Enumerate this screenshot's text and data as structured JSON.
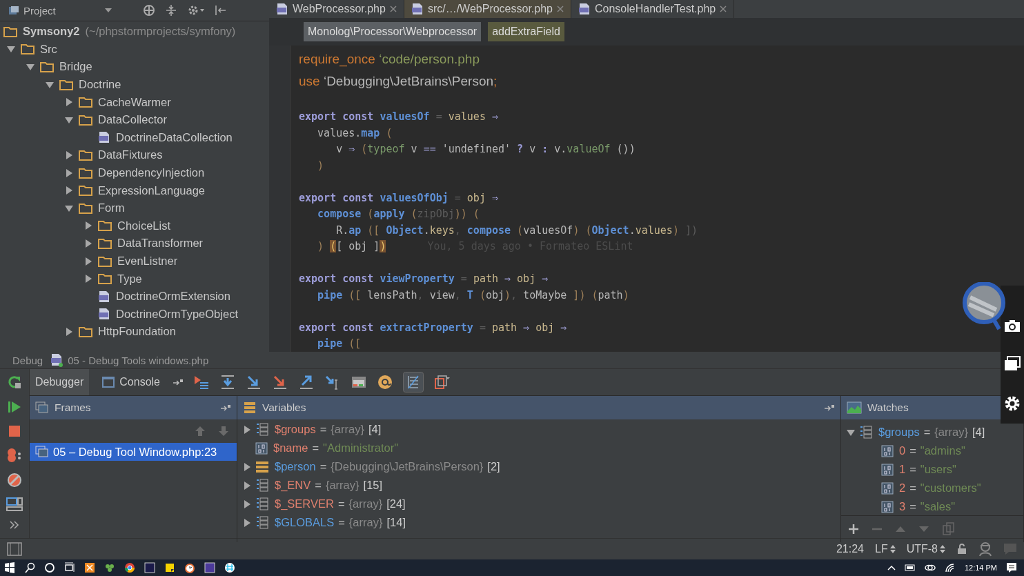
{
  "project_panel": {
    "title": "Project"
  },
  "editor_tabs": [
    {
      "label": "WebProcessor.php",
      "selected": false
    },
    {
      "label": "src/…/WebProcessor.php",
      "selected": true
    },
    {
      "label": "ConsoleHandlerTest.php",
      "selected": false
    }
  ],
  "breadcrumbs": [
    {
      "label": "Monolog\\Processor\\Webprocessor",
      "kind": "class"
    },
    {
      "label": "addExtraField",
      "kind": "method"
    }
  ],
  "tree": [
    {
      "label": "Symsony2",
      "path": "(~/phpstormprojects/symfony)",
      "kind": "project",
      "children": [
        {
          "label": "Src",
          "kind": "folder",
          "expanded": true,
          "children": [
            {
              "label": "Bridge",
              "kind": "folder",
              "expanded": true,
              "children": [
                {
                  "label": "Doctrine",
                  "kind": "folder",
                  "expanded": true,
                  "children": [
                    {
                      "label": "CacheWarmer",
                      "kind": "folder",
                      "expanded": false
                    },
                    {
                      "label": "DataCollector",
                      "kind": "folder",
                      "expanded": true,
                      "children": [
                        {
                          "label": "DoctrineDataCollection",
                          "kind": "file"
                        }
                      ]
                    },
                    {
                      "label": "DataFixtures",
                      "kind": "folder",
                      "expanded": false
                    },
                    {
                      "label": "DependencyInjection",
                      "kind": "folder",
                      "expanded": false
                    },
                    {
                      "label": "ExpressionLanguage",
                      "kind": "folder",
                      "expanded": false
                    },
                    {
                      "label": "Form",
                      "kind": "folder",
                      "expanded": true,
                      "children": [
                        {
                          "label": "ChoiceList",
                          "kind": "folder",
                          "expanded": false
                        },
                        {
                          "label": "DataTransformer",
                          "kind": "folder",
                          "expanded": false
                        },
                        {
                          "label": "EvenListner",
                          "kind": "folder",
                          "expanded": false
                        },
                        {
                          "label": "Type",
                          "kind": "folder",
                          "expanded": false
                        },
                        {
                          "label": "DoctrineOrmExtension",
                          "kind": "file"
                        },
                        {
                          "label": "DoctrineOrmTypeObject",
                          "kind": "file"
                        }
                      ]
                    },
                    {
                      "label": "HttpFoundation",
                      "kind": "folder",
                      "expanded": false
                    }
                  ]
                }
              ]
            }
          ]
        }
      ]
    }
  ],
  "code": [
    {
      "kind": "php",
      "tokens": [
        {
          "text": "require_once",
          "kind": "kw"
        },
        {
          "text": " ‘code/person.php",
          "kind": "str"
        }
      ]
    },
    {
      "kind": "php",
      "tokens": [
        {
          "text": "use",
          "kind": "kw"
        },
        {
          "text": " ‘Debugging\\JetBrains\\Person",
          "kind": "plain"
        },
        {
          "text": ";",
          "kind": "kw"
        }
      ]
    },
    {
      "kind": "blank"
    },
    {
      "kind": "code",
      "tokens": [
        {
          "text": "export const ",
          "kind": "decl"
        },
        {
          "text": "valuesOf",
          "kind": "fn"
        },
        {
          "text": " = ",
          "kind": "dim"
        },
        {
          "text": "values",
          "kind": "param"
        },
        {
          "text": " ⇒",
          "kind": "arrow"
        }
      ]
    },
    {
      "kind": "code",
      "tokens": [
        {
          "text": "   values.",
          "kind": "plain"
        },
        {
          "text": "map",
          "kind": "fn"
        },
        {
          "text": " (",
          "kind": "paren"
        }
      ]
    },
    {
      "kind": "code",
      "tokens": [
        {
          "text": "      v ",
          "kind": "plain"
        },
        {
          "text": "⇒ ",
          "kind": "arrow"
        },
        {
          "text": "(",
          "kind": "paren"
        },
        {
          "text": "typeof",
          "kind": "special"
        },
        {
          "text": " v ",
          "kind": "plain"
        },
        {
          "text": "== ",
          "kind": "arrow"
        },
        {
          "text": "'undefined' ",
          "kind": "plain"
        },
        {
          "text": "? ",
          "kind": "decl"
        },
        {
          "text": "v ",
          "kind": "plain"
        },
        {
          "text": ": ",
          "kind": "decl"
        },
        {
          "text": "v.",
          "kind": "plain"
        },
        {
          "text": "valueOf",
          "kind": "special"
        },
        {
          "text": " ())",
          "kind": "plain"
        }
      ]
    },
    {
      "kind": "code",
      "tokens": [
        {
          "text": "   )",
          "kind": "paren"
        }
      ]
    },
    {
      "kind": "blank"
    },
    {
      "kind": "code",
      "tokens": [
        {
          "text": "export const ",
          "kind": "decl"
        },
        {
          "text": "valuesOfObj",
          "kind": "fn"
        },
        {
          "text": " = ",
          "kind": "dim"
        },
        {
          "text": "obj",
          "kind": "param"
        },
        {
          "text": " ⇒",
          "kind": "arrow"
        }
      ]
    },
    {
      "kind": "code",
      "tokens": [
        {
          "text": "   compose",
          "kind": "fn"
        },
        {
          "text": " (",
          "kind": "paren"
        },
        {
          "text": "apply",
          "kind": "fn"
        },
        {
          "text": " (",
          "kind": "paren"
        },
        {
          "text": "zipObj",
          "kind": "dim"
        },
        {
          "text": "))",
          "kind": "paren"
        },
        {
          "text": " (",
          "kind": "paren"
        }
      ]
    },
    {
      "kind": "code",
      "tokens": [
        {
          "text": "      R.",
          "kind": "plain"
        },
        {
          "text": "ap",
          "kind": "fn"
        },
        {
          "text": " ([ ",
          "kind": "paren"
        },
        {
          "text": "Object",
          "kind": "fn"
        },
        {
          "text": ".",
          "kind": "plain"
        },
        {
          "text": "keys",
          "kind": "param"
        },
        {
          "text": ", ",
          "kind": "dim"
        },
        {
          "text": "compose",
          "kind": "fn"
        },
        {
          "text": " (",
          "kind": "paren"
        },
        {
          "text": "valuesOf",
          "kind": "plain"
        },
        {
          "text": ")",
          "kind": "paren"
        },
        {
          "text": " (",
          "kind": "paren"
        },
        {
          "text": "Object",
          "kind": "fn"
        },
        {
          "text": ".",
          "kind": "plain"
        },
        {
          "text": "values",
          "kind": "param"
        },
        {
          "text": ")",
          "kind": "paren"
        },
        {
          "text": " ])",
          "kind": "dim"
        }
      ]
    },
    {
      "kind": "code",
      "tokens": [
        {
          "text": "   ) ",
          "kind": "paren"
        },
        {
          "text": "(",
          "kind": "match"
        },
        {
          "text": "[ obj ]",
          "kind": "plain"
        },
        {
          "text": ")",
          "kind": "match"
        }
      ],
      "blame": "You, 5 days ago • Formateo ESLint"
    },
    {
      "kind": "blank"
    },
    {
      "kind": "code",
      "tokens": [
        {
          "text": "export const ",
          "kind": "decl"
        },
        {
          "text": "viewProperty",
          "kind": "fn"
        },
        {
          "text": " = ",
          "kind": "dim"
        },
        {
          "text": "path",
          "kind": "param"
        },
        {
          "text": " ⇒ ",
          "kind": "arrow"
        },
        {
          "text": "obj",
          "kind": "param"
        },
        {
          "text": " ⇒",
          "kind": "arrow"
        }
      ]
    },
    {
      "kind": "code",
      "tokens": [
        {
          "text": "   pipe",
          "kind": "fn"
        },
        {
          "text": " ([",
          "kind": "paren"
        },
        {
          "text": " lensPath",
          "kind": "plain"
        },
        {
          "text": ",",
          "kind": "dim"
        },
        {
          "text": " view",
          "kind": "plain"
        },
        {
          "text": ",",
          "kind": "dim"
        },
        {
          "text": " T",
          "kind": "fn"
        },
        {
          "text": " (",
          "kind": "paren"
        },
        {
          "text": "obj",
          "kind": "plain"
        },
        {
          "text": ")",
          "kind": "paren"
        },
        {
          "text": ",",
          "kind": "dim"
        },
        {
          "text": " toMaybe",
          "kind": "plain"
        },
        {
          "text": " ])",
          "kind": "paren"
        },
        {
          "text": " (",
          "kind": "paren"
        },
        {
          "text": "path",
          "kind": "plain"
        },
        {
          "text": ")",
          "kind": "paren"
        }
      ]
    },
    {
      "kind": "blank"
    },
    {
      "kind": "code",
      "tokens": [
        {
          "text": "export const ",
          "kind": "decl"
        },
        {
          "text": "extractProperty",
          "kind": "fn"
        },
        {
          "text": " = ",
          "kind": "dim"
        },
        {
          "text": "path",
          "kind": "param"
        },
        {
          "text": " ⇒ ",
          "kind": "arrow"
        },
        {
          "text": "obj",
          "kind": "param"
        },
        {
          "text": " ⇒",
          "kind": "arrow"
        }
      ]
    },
    {
      "kind": "code",
      "tokens": [
        {
          "text": "   pipe",
          "kind": "fn"
        },
        {
          "text": " ([",
          "kind": "paren"
        }
      ]
    }
  ],
  "debug": {
    "label": "Debug",
    "config": "05 - Debug Tools windows.php",
    "tabs": [
      {
        "label": "Debugger",
        "selected": true
      },
      {
        "label": "Console",
        "selected": false
      }
    ],
    "frames": {
      "title": "Frames",
      "items": [
        {
          "label": "05 – Debug Tool Window.php:23",
          "selected": true
        }
      ]
    },
    "variables": {
      "title": "Variables",
      "items": [
        {
          "name": "$groups",
          "color": "#e0806e",
          "kind": "array",
          "op": "=",
          "type": "{array}",
          "count": "[4]"
        },
        {
          "name": "$name",
          "color": "#e0806e",
          "kind": "string",
          "op": "=",
          "value": "\"Administrator\""
        },
        {
          "name": "$person",
          "color": "#5a9de0",
          "kind": "object",
          "op": "=",
          "type": "{Debugging\\JetBrains\\Person}",
          "count": "[2]"
        },
        {
          "name": "$_ENV",
          "color": "#e0806e",
          "kind": "array",
          "op": "=",
          "type": "{array}",
          "count": "[15]"
        },
        {
          "name": "$_SERVER",
          "color": "#e0806e",
          "kind": "array",
          "op": "=",
          "type": "{array}",
          "count": "[24]"
        },
        {
          "name": "$GLOBALS",
          "color": "#5a9de0",
          "kind": "array",
          "op": "=",
          "type": "{array}",
          "count": "[14]"
        }
      ]
    },
    "watches": {
      "title": "Watches",
      "items": [
        {
          "name": "$groups",
          "color": "#5a9de0",
          "kind": "array",
          "op": "=",
          "type": "{array}",
          "count": "[4]",
          "expanded": true,
          "children": [
            {
              "name": "0",
              "color": "#e0806e",
              "kind": "string",
              "op": "=",
              "value": "\"admins\""
            },
            {
              "name": "1",
              "color": "#e0806e",
              "kind": "string",
              "op": "=",
              "value": "\"users\""
            },
            {
              "name": "2",
              "color": "#e0806e",
              "kind": "string",
              "op": "=",
              "value": "\"customers\""
            },
            {
              "name": "3",
              "color": "#e0806e",
              "kind": "string",
              "op": "=",
              "value": "\"sales\""
            }
          ]
        }
      ]
    }
  },
  "status_bar": {
    "position": "21:24",
    "line_ending": "LF",
    "encoding": "UTF-8"
  },
  "taskbar": {
    "time": "12:14 PM"
  }
}
